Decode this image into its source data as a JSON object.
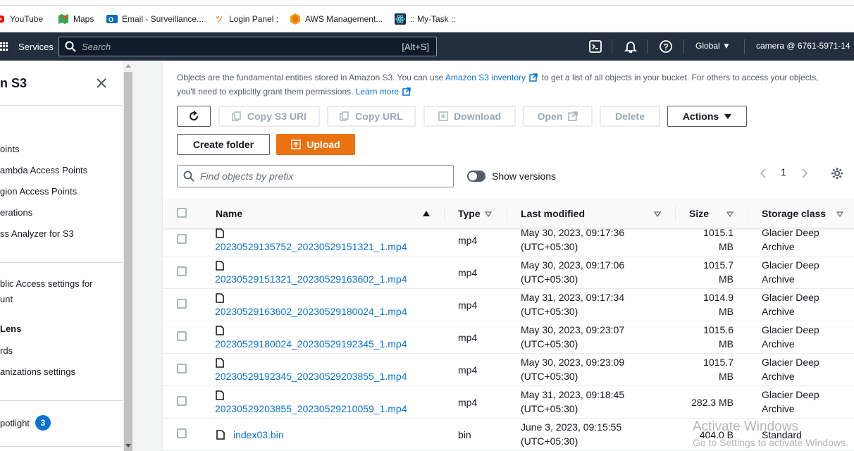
{
  "bookmarks": [
    {
      "label": "YouTube",
      "icon": "youtube-icon",
      "color": "#ff0000"
    },
    {
      "label": "Maps",
      "icon": "maps-icon",
      "color": "#34a853"
    },
    {
      "label": "Email - Surveillance...",
      "icon": "outlook-icon",
      "color": "#0f6cbd"
    },
    {
      "label": "Login Panel :",
      "icon": "login-icon",
      "color": "#f28b30"
    },
    {
      "label": "AWS Management...",
      "icon": "aws-icon",
      "color": "#ff9900"
    },
    {
      "label": ":: My-Task ::",
      "icon": "react-icon",
      "color": "#203040"
    }
  ],
  "nav": {
    "services": "Services",
    "search_placeholder": "Search",
    "search_shortcut": "[Alt+S]",
    "region": "Global",
    "account": "camera @ 6761-5971-14"
  },
  "sidebar": {
    "title": "n S3",
    "items": [
      "oints",
      "ambda Access Points",
      "gion Access Points",
      "erations",
      "ss Analyzer for S3",
      "blic Access settings for",
      "unt",
      "Lens",
      "rds",
      "anizations settings",
      "potlight"
    ],
    "spotlight_badge": "3"
  },
  "main": {
    "description_1": "Objects are the fundamental entities stored in Amazon S3. You can use ",
    "inventory_link": "Amazon S3 inventory",
    "description_2": " to get a list of all objects in your bucket. For others to access your objects,",
    "description_3": "you'll need to explicitly grant them permissions. ",
    "learn_more": "Learn more",
    "buttons": {
      "copy_s3_uri": "Copy S3 URI",
      "copy_url": "Copy URL",
      "download": "Download",
      "open": "Open",
      "delete": "Delete",
      "actions": "Actions",
      "create_folder": "Create folder",
      "upload": "Upload"
    },
    "filter_placeholder": "Find objects by prefix",
    "show_versions": "Show versions",
    "page": "1",
    "columns": {
      "name": "Name",
      "type": "Type",
      "last_modified": "Last modified",
      "size": "Size",
      "storage_class": "Storage class"
    },
    "rows": [
      {
        "name": "20230529135752_20230529151321_1.mp4",
        "type": "mp4",
        "modified_1": "May 30, 2023, 09:17:36",
        "modified_2": "(UTC+05:30)",
        "size_1": "1015.1",
        "size_2": "MB",
        "class_1": "Glacier Deep",
        "class_2": "Archive"
      },
      {
        "name": "20230529151321_20230529163602_1.mp4",
        "type": "mp4",
        "modified_1": "May 30, 2023, 09:17:06",
        "modified_2": "(UTC+05:30)",
        "size_1": "1015.7",
        "size_2": "MB",
        "class_1": "Glacier Deep",
        "class_2": "Archive"
      },
      {
        "name": "20230529163602_20230529180024_1.mp4",
        "type": "mp4",
        "modified_1": "May 31, 2023, 09:17:34",
        "modified_2": "(UTC+05:30)",
        "size_1": "1014.9",
        "size_2": "MB",
        "class_1": "Glacier Deep",
        "class_2": "Archive"
      },
      {
        "name": "20230529180024_20230529192345_1.mp4",
        "type": "mp4",
        "modified_1": "May 30, 2023, 09:23:07",
        "modified_2": "(UTC+05:30)",
        "size_1": "1015.6",
        "size_2": "MB",
        "class_1": "Glacier Deep",
        "class_2": "Archive"
      },
      {
        "name": "20230529192345_20230529203855_1.mp4",
        "type": "mp4",
        "modified_1": "May 30, 2023, 09:23:09",
        "modified_2": "(UTC+05:30)",
        "size_1": "1015.7",
        "size_2": "MB",
        "class_1": "Glacier Deep",
        "class_2": "Archive"
      },
      {
        "name": "20230529203855_20230529210059_1.mp4",
        "type": "mp4",
        "modified_1": "May 31, 2023, 09:18:45",
        "modified_2": "(UTC+05:30)",
        "size_1": "282.3 MB",
        "size_2": "",
        "class_1": "Glacier Deep",
        "class_2": "Archive"
      },
      {
        "name": "index03.bin",
        "type": "bin",
        "modified_1": "June 3, 2023, 09:15:55",
        "modified_2": "(UTC+05:30)",
        "size_1": "404.0 B",
        "size_2": "",
        "class_1": "Standard",
        "class_2": ""
      }
    ]
  },
  "watermark": {
    "line1": "Activate Windows",
    "line2": "Go to Settings to activate Windows."
  },
  "colors": {
    "aws_nav": "#232f3e",
    "link": "#0972d3",
    "upload": "#ec7211"
  }
}
